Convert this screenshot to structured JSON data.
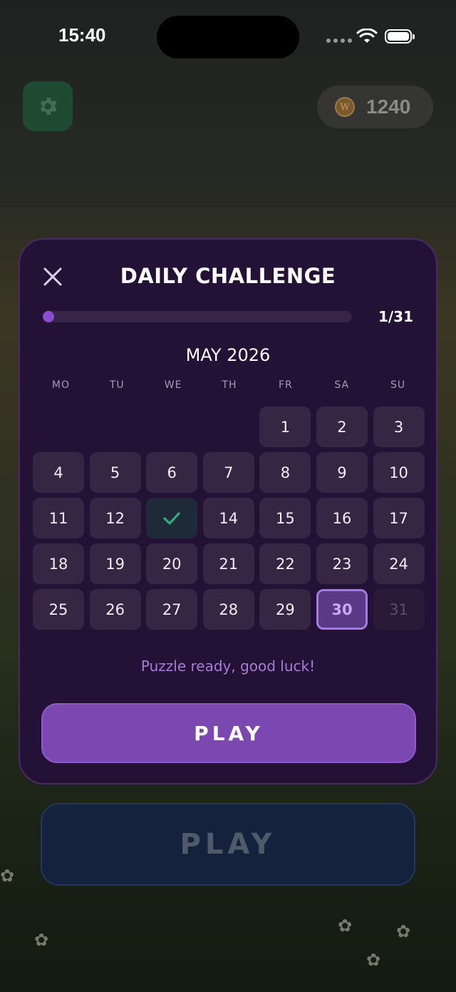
{
  "status_bar": {
    "time": "15:40"
  },
  "top_bar": {
    "coin_count": "1240",
    "coin_symbol": "W"
  },
  "modal": {
    "title": "DAILY CHALLENGE",
    "progress": {
      "label": "1/31",
      "fraction": 0.032
    },
    "month": "MAY 2026",
    "weekdays": [
      "MO",
      "TU",
      "WE",
      "TH",
      "FR",
      "SA",
      "SU"
    ],
    "days": {
      "d1": "1",
      "d2": "2",
      "d3": "3",
      "d4": "4",
      "d5": "5",
      "d7": "7",
      "d8": "8",
      "d9": "9",
      "d10": "10",
      "d11": "11",
      "d12": "12",
      "d14": "14",
      "d15": "15",
      "d16": "16",
      "d17": "17",
      "d18": "18",
      "d19": "19",
      "d20": "20",
      "d21": "21",
      "d22": "22",
      "d23": "23",
      "d24": "24",
      "d25": "25",
      "d26": "26",
      "d27": "27",
      "d28": "28",
      "d29": "29",
      "d30": "30",
      "d31": "31"
    },
    "status_message": "Puzzle ready, good luck!",
    "play_label": "PLAY"
  },
  "background": {
    "play_label": "PLAY"
  },
  "icons": {
    "settings": "gear-icon",
    "close": "close-icon",
    "check": "checkmark-icon",
    "coin": "coin-icon"
  },
  "colors": {
    "accent": "#7a48b0",
    "today_border": "#a27ce0",
    "check": "#2fae7a",
    "modal_bg": "#231136"
  }
}
